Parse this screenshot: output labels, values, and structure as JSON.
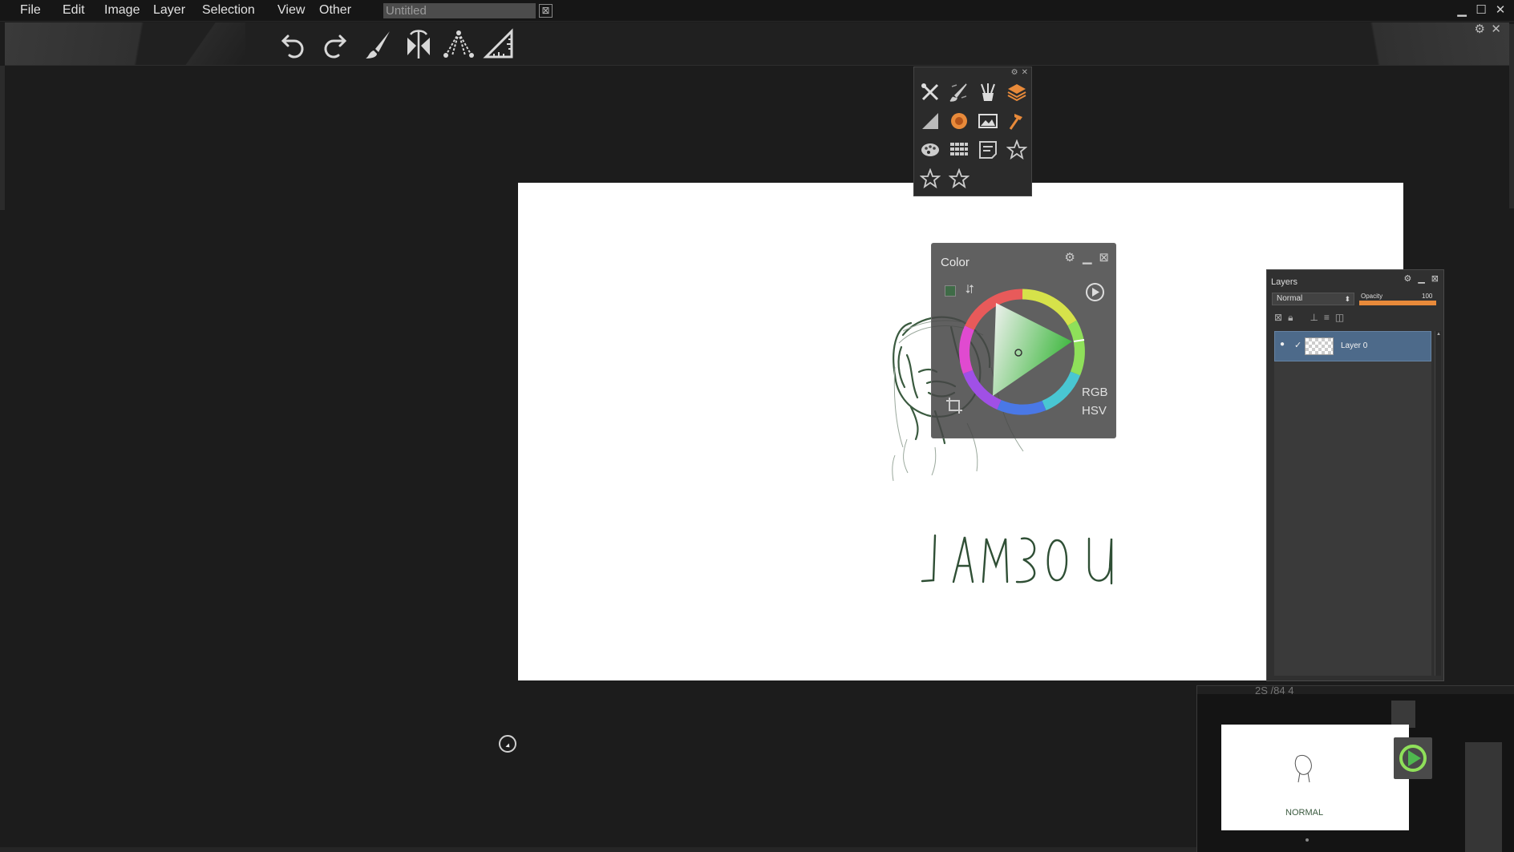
{
  "menubar": {
    "items": [
      "File",
      "Edit",
      "Image",
      "Layer",
      "Selection",
      "View",
      "Other"
    ],
    "document_title": "Untitled",
    "title_close": "⊠",
    "window_controls": [
      "▁",
      "☐",
      "✕"
    ]
  },
  "toolbar": {
    "tools": [
      "undo-icon",
      "redo-icon",
      "brush-icon",
      "symmetry-icon",
      "perspective-icon",
      "ruler-icon"
    ],
    "settings": "⚙",
    "close": "✕"
  },
  "tool_panel": {
    "settings": "⚙",
    "close": "✕"
  },
  "color_panel": {
    "title": "Color",
    "settings": "⚙",
    "minimize": "▁",
    "close": "⊠",
    "mode_rgb": "RGB",
    "mode_hsv": "HSV",
    "swap": "⮃",
    "current_color": "#3f6b47"
  },
  "layers_panel": {
    "title": "Layers",
    "settings": "⚙",
    "minimize": "▁",
    "close": "⊠",
    "blend_mode": "Normal",
    "blend_arrow": "⬍",
    "opacity_label": "Opacity",
    "opacity_value": "100",
    "opacity_fraction": 1.0,
    "layers": [
      {
        "name": "Layer 0",
        "visible": true,
        "selected": true
      }
    ],
    "eye": "●",
    "check": "✓",
    "scroll_up": "▲"
  },
  "navigator": {
    "zoom_text": "2S /84 4"
  },
  "canvas": {
    "text": "NORMAL"
  },
  "colors": {
    "accent": "#e88a3a",
    "layer_selected": "#4d6a8a",
    "ink": "#3a5a3f"
  }
}
